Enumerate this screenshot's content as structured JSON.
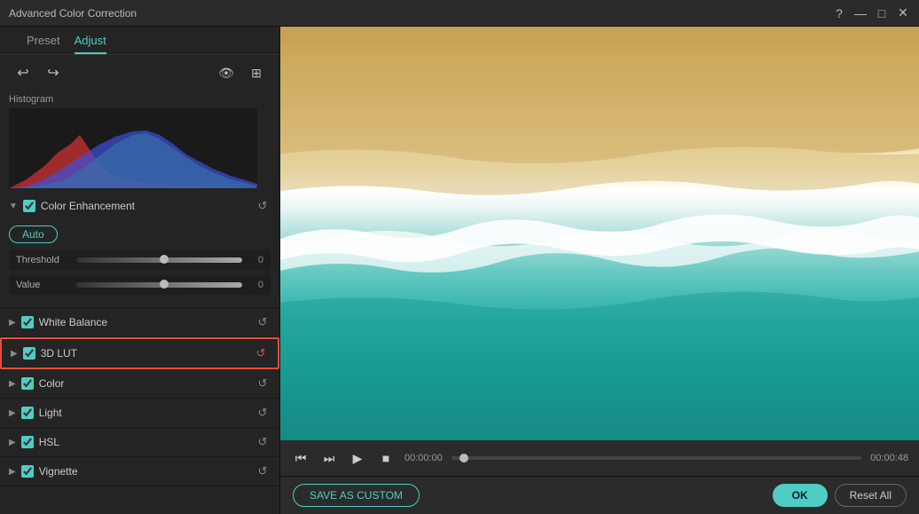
{
  "titleBar": {
    "title": "Advanced Color Correction",
    "helpBtn": "?",
    "minimizeBtn": "—",
    "maximizeBtn": "□",
    "closeBtn": "✕"
  },
  "tabs": [
    {
      "id": "preset",
      "label": "Preset",
      "active": false
    },
    {
      "id": "adjust",
      "label": "Adjust",
      "active": true
    }
  ],
  "toolbar": {
    "undoLabel": "↩",
    "redoLabel": "↪"
  },
  "histogram": {
    "label": "Histogram"
  },
  "sections": [
    {
      "id": "color-enhancement",
      "title": "Color Enhancement",
      "checked": true,
      "expanded": true,
      "highlighted": false
    },
    {
      "id": "white-balance",
      "title": "White Balance",
      "checked": true,
      "expanded": false,
      "highlighted": false
    },
    {
      "id": "3d-lut",
      "title": "3D LUT",
      "checked": true,
      "expanded": false,
      "highlighted": true
    },
    {
      "id": "color",
      "title": "Color",
      "checked": true,
      "expanded": false,
      "highlighted": false
    },
    {
      "id": "light",
      "title": "Light",
      "checked": true,
      "expanded": false,
      "highlighted": false
    },
    {
      "id": "hsl",
      "title": "HSL",
      "checked": true,
      "expanded": false,
      "highlighted": false
    },
    {
      "id": "vignette",
      "title": "Vignette",
      "checked": true,
      "expanded": false,
      "highlighted": false
    }
  ],
  "colorEnhancement": {
    "autoLabel": "Auto",
    "sliders": [
      {
        "id": "threshold",
        "label": "Threshold",
        "value": "0"
      },
      {
        "id": "value",
        "label": "Value",
        "value": "0"
      }
    ]
  },
  "player": {
    "timeStart": "00:00:00",
    "timeEnd": "00:00:48"
  },
  "bottomBar": {
    "saveCustomLabel": "SAVE AS CUSTOM",
    "okLabel": "OK",
    "resetAllLabel": "Reset All"
  },
  "headerIcons": {
    "eye": "👁",
    "split": "⊞"
  }
}
